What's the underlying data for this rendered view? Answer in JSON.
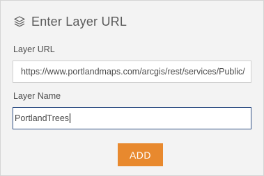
{
  "header": {
    "icon": "layers-icon",
    "title": "Enter Layer URL"
  },
  "form": {
    "url_label": "Layer URL",
    "url_value": "https://www.portlandmaps.com/arcgis/rest/services/Public/",
    "name_label": "Layer Name",
    "name_value": "PortlandTrees",
    "add_label": "ADD"
  },
  "colors": {
    "panel_bg": "#f3f3f3",
    "accent": "#e8892e",
    "focus_border": "#2f4f84"
  }
}
